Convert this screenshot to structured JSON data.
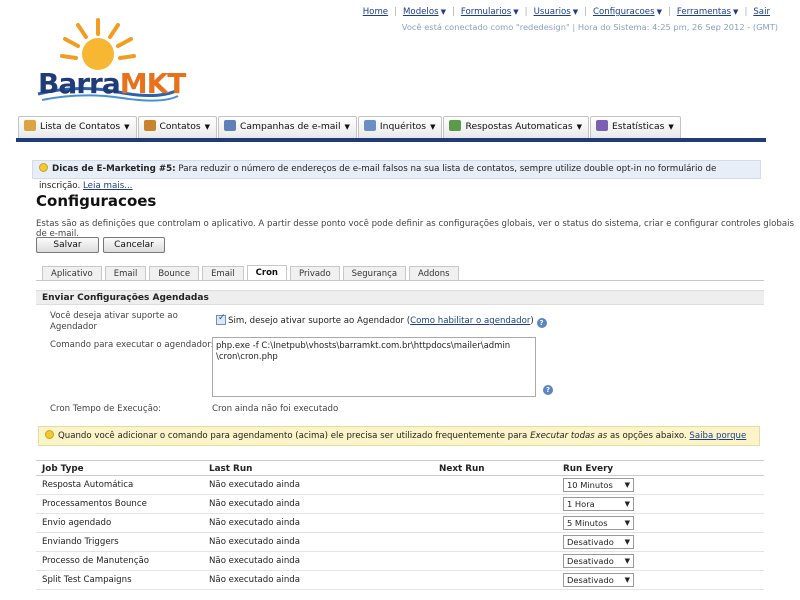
{
  "topnav": {
    "items": [
      {
        "label": "Home",
        "dropdown": false
      },
      {
        "label": "Modelos",
        "dropdown": true
      },
      {
        "label": "Formularios",
        "dropdown": true
      },
      {
        "label": "Usuarios",
        "dropdown": true
      },
      {
        "label": "Configuracoes",
        "dropdown": true
      },
      {
        "label": "Ferramentas",
        "dropdown": true
      },
      {
        "label": "Sair",
        "dropdown": false
      }
    ],
    "status": "Você está conectado como \"rededesign\" | Hora do Sistema: 4:25 pm, 26 Sep 2012 - (GMT)"
  },
  "logo": {
    "part1": "Barra",
    "part2": "MKT"
  },
  "main_tabs": [
    {
      "label": "Lista de Contatos",
      "icon": "contacts-list-icon",
      "color": "#d9a441"
    },
    {
      "label": "Contatos",
      "icon": "contacts-icon",
      "color": "#c9832e"
    },
    {
      "label": "Campanhas de e-mail",
      "icon": "email-icon",
      "color": "#5f7fb8"
    },
    {
      "label": "Inquéritos",
      "icon": "survey-icon",
      "color": "#6b8fc4"
    },
    {
      "label": "Respostas Automaticas",
      "icon": "autoresponder-icon",
      "color": "#5a9a4a"
    },
    {
      "label": "Estatísticas",
      "icon": "stats-icon",
      "color": "#7a5fb5"
    }
  ],
  "tip": {
    "title": "Dicas de E-Marketing #5:",
    "text": " Para reduzir o número de endereços de e-mail falsos na sua lista de contatos, sempre utilize double opt-in no formulário de inscrição. ",
    "link": "Leia mais..."
  },
  "page": {
    "title": "Configuracoes",
    "intro": "Estas são as definições que controlam o aplicativo. A partir desse ponto você pode definir as configurações globais, ver o status do sistema, criar e configurar controles globais de e-mail.",
    "save_label": "Salvar",
    "cancel_label": "Cancelar"
  },
  "sub_tabs": [
    "Aplicativo",
    "Email",
    "Bounce",
    "Email",
    "Cron",
    "Privado",
    "Segurança",
    "Addons"
  ],
  "active_sub_tab": "Cron",
  "cron": {
    "section_title": "Enviar Configurações Agendadas",
    "enable_label": "Você deseja ativar suporte ao Agendador",
    "enable_checkbox_text": "Sim, desejo ativar suporte ao Agendador (",
    "enable_link": "Como habilitar o agendador",
    "enable_close": ")",
    "command_label": "Comando para executar o agendador:",
    "command_line1": "php.exe -f C:\\Inetpub\\vhosts\\barramkt.com.br\\httpdocs\\mailer\\admin",
    "command_line2": "\\cron\\cron.php",
    "runtime_label": "Cron Tempo de Execução:",
    "runtime_value": "Cron ainda não foi executado"
  },
  "warning": {
    "text1": "Quando você adicionar o comando para agendamento (acima) ele precisa ser utilizado frequentemente para ",
    "italic": "Executar todas as",
    "text2": " as opções abaixo. ",
    "link": "Saiba porque"
  },
  "jobs_table": {
    "headers": [
      "Job Type",
      "Last Run",
      "Next Run",
      "Run Every"
    ],
    "rows": [
      {
        "job": "Resposta Automática",
        "last": "Não executado ainda",
        "next": "",
        "every": "10 Minutos"
      },
      {
        "job": "Processamentos Bounce",
        "last": "Não executado ainda",
        "next": "",
        "every": "1 Hora"
      },
      {
        "job": "Envio agendado",
        "last": "Não executado ainda",
        "next": "",
        "every": "5 Minutos"
      },
      {
        "job": "Enviando Triggers",
        "last": "Não executado ainda",
        "next": "",
        "every": "Desativado"
      },
      {
        "job": "Processo de Manutenção",
        "last": "Não executado ainda",
        "next": "",
        "every": "Desativado"
      },
      {
        "job": "Split Test Campaigns",
        "last": "Não executado ainda",
        "next": "",
        "every": "Desativado"
      }
    ]
  },
  "colors": {
    "brand_blue": "#1f3b78",
    "brand_orange": "#e8721c",
    "link": "#1c3e8c"
  }
}
